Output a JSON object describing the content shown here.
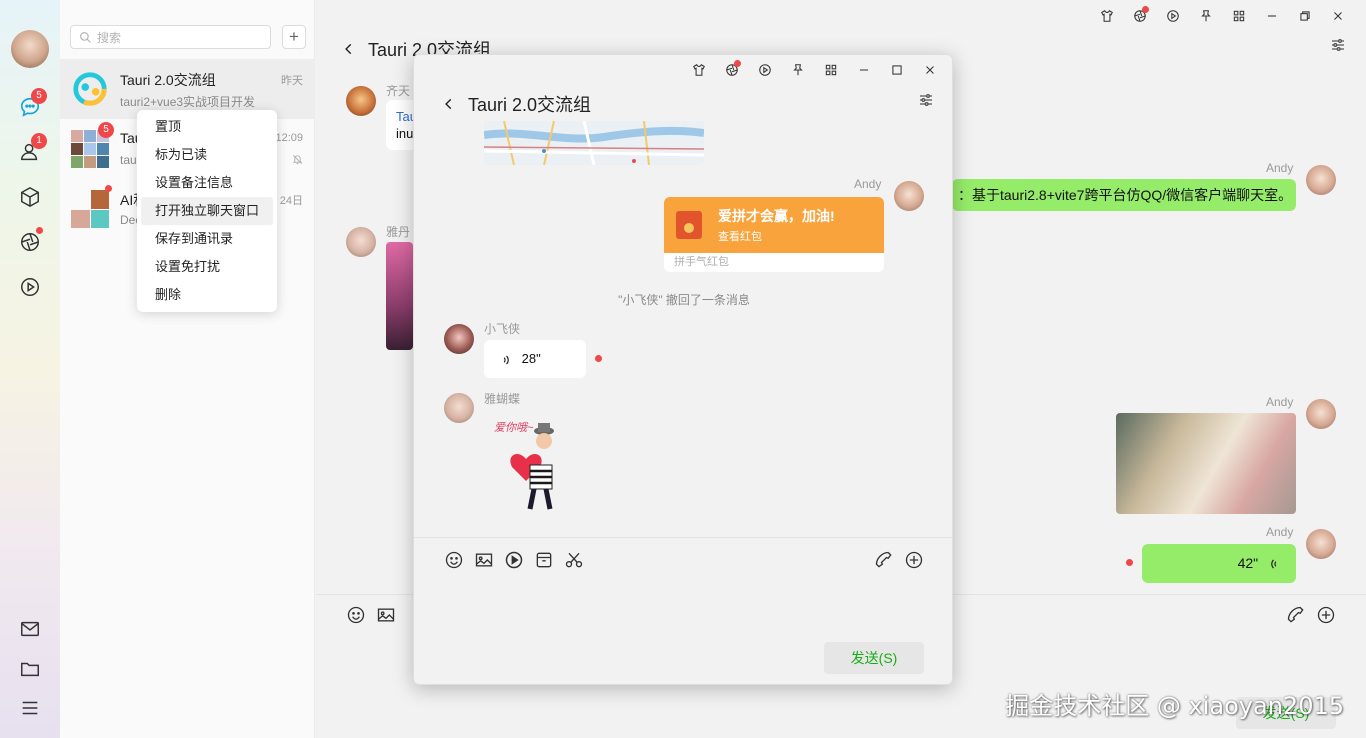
{
  "rail": {
    "badges": {
      "chat": "5",
      "contacts": "1"
    }
  },
  "sidebar": {
    "search_placeholder": "搜索",
    "conversations": [
      {
        "name": "Tauri 2.0交流组",
        "preview": "tauri2+vue3实战项目开发",
        "time": "昨天",
        "badge": ""
      },
      {
        "name": "Tau",
        "preview": "tau",
        "time": "12:09",
        "badge": "5"
      },
      {
        "name": "AI和",
        "preview": "Dec",
        "time": "24日",
        "badge": ""
      }
    ]
  },
  "context_menu": {
    "items": [
      "置顶",
      "标为已读",
      "设置备注信息",
      "打开独立聊天窗口",
      "保存到通讯录",
      "设置免打扰",
      "删除"
    ]
  },
  "main": {
    "title": "Tauri 2.0交流组",
    "senders": {
      "qi": "齐天",
      "ya": "雅丹",
      "andy1": "Andy",
      "andy2": "Andy",
      "andy3": "Andy"
    },
    "qi_bubble_line1": "Tau",
    "qi_bubble_line2": "inu",
    "andy_text": "：基于tauri2.8+vite7跨平台仿QQ/微信客户端聊天室。",
    "voice_duration": "42\"",
    "send_label": "发送(S)"
  },
  "popup": {
    "title": "Tauri 2.0交流组",
    "redpack_sender": "Andy",
    "redpack_title": "爱拼才会赢，加油!",
    "redpack_sub": "查看红包",
    "redpack_footer": "拼手气红包",
    "system_msg": "\"小飞侠\" 撤回了一条消息",
    "voice_sender": "小飞侠",
    "voice_duration": "28\"",
    "sticker_sender": "雅蝴蝶",
    "sticker_caption": "爱你哦~",
    "send_label": "发送(S)"
  },
  "watermark": "掘金技术社区 @ xiaoyan2015",
  "colors": {
    "accent_green": "#95ec69",
    "send_text": "#1aad19",
    "badge_red": "#f04848",
    "redpack_orange": "#f8a33c"
  }
}
